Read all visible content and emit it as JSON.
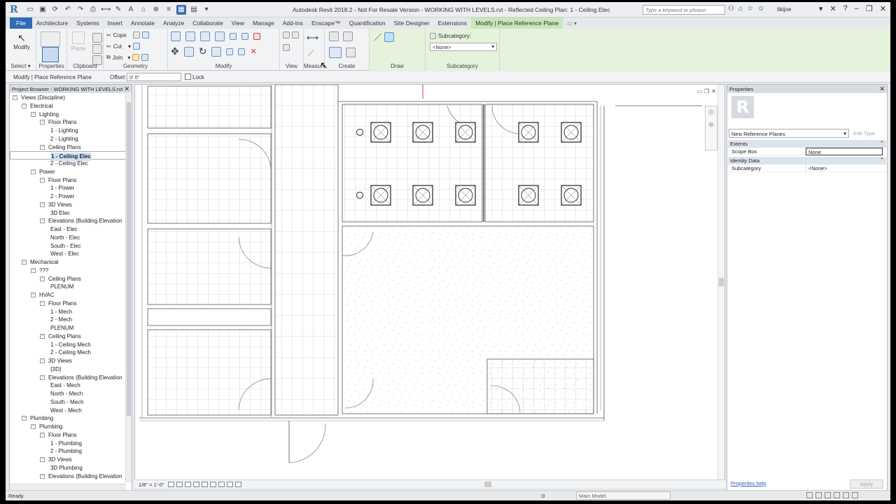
{
  "window": {
    "title": "Autodesk Revit 2018.2 - Not For Resale Version -    WORKING WITH LEVELS.rvt - Reflected Ceiling Plan: 1 - Ceiling Elec",
    "search_placeholder": "Type a keyword or phrase",
    "user": "tikijoe"
  },
  "ribbon_tabs": [
    "File",
    "Architecture",
    "Systems",
    "Insert",
    "Annotate",
    "Analyze",
    "Collaborate",
    "View",
    "Manage",
    "Add-Ins",
    "Enscape™",
    "Quantification",
    "Site Designer",
    "Extensions",
    "Modify | Place Reference Plane"
  ],
  "ribbon": {
    "modify": "Modify",
    "paste": "Paste",
    "cope": "Cope",
    "cut": "Cut",
    "join": "Join",
    "subcategory_label": "Subcategory:",
    "subcategory_value": "<None>",
    "panels": {
      "select": "Select",
      "properties": "Properties",
      "clipboard": "Clipboard",
      "geometry": "Geometry",
      "modify": "Modify",
      "view": "View",
      "measure": "Measure",
      "create": "Create",
      "draw": "Draw",
      "subcategory": "Subcategory"
    }
  },
  "options_bar": {
    "mode": "Modify | Place Reference Plane",
    "offset_label": "Offset:",
    "offset_value": "0' 0\"",
    "lock_label": "Lock"
  },
  "project_browser": {
    "title": "Project Browser - WORKING WITH LEVELS.rvt",
    "items": [
      {
        "label": "Views (Discipline)",
        "level": 0
      },
      {
        "label": "Electrical",
        "level": 1
      },
      {
        "label": "Lighting",
        "level": 2
      },
      {
        "label": "Floor Plans",
        "level": 3
      },
      {
        "label": "1 - Lighting",
        "level": 4
      },
      {
        "label": "2 - Lighting",
        "level": 4
      },
      {
        "label": "Ceiling Plans",
        "level": 3
      },
      {
        "label": "1 - Ceiling Elec",
        "level": 4,
        "selected": true
      },
      {
        "label": "2 - Ceiling Elec",
        "level": 4
      },
      {
        "label": "Power",
        "level": 2
      },
      {
        "label": "Floor Plans",
        "level": 3
      },
      {
        "label": "1 - Power",
        "level": 4
      },
      {
        "label": "2 - Power",
        "level": 4
      },
      {
        "label": "3D Views",
        "level": 3
      },
      {
        "label": "3D Elec",
        "level": 4
      },
      {
        "label": "Elevations (Building Elevation",
        "level": 3
      },
      {
        "label": "East - Elec",
        "level": 4
      },
      {
        "label": "North - Elec",
        "level": 4
      },
      {
        "label": "South - Elec",
        "level": 4
      },
      {
        "label": "West - Elec",
        "level": 4
      },
      {
        "label": "Mechanical",
        "level": 1
      },
      {
        "label": "???",
        "level": 2
      },
      {
        "label": "Ceiling Plans",
        "level": 3
      },
      {
        "label": "PLENUM",
        "level": 4
      },
      {
        "label": "HVAC",
        "level": 2
      },
      {
        "label": "Floor Plans",
        "level": 3
      },
      {
        "label": "1 - Mech",
        "level": 4
      },
      {
        "label": "2 - Mech",
        "level": 4
      },
      {
        "label": "PLENUM",
        "level": 4
      },
      {
        "label": "Ceiling Plans",
        "level": 3
      },
      {
        "label": "1 - Ceiling Mech",
        "level": 4
      },
      {
        "label": "2 - Ceiling Mech",
        "level": 4
      },
      {
        "label": "3D Views",
        "level": 3
      },
      {
        "label": "{3D}",
        "level": 4
      },
      {
        "label": "Elevations (Building Elevation",
        "level": 3
      },
      {
        "label": "East - Mech",
        "level": 4
      },
      {
        "label": "North - Mech",
        "level": 4
      },
      {
        "label": "South - Mech",
        "level": 4
      },
      {
        "label": "West - Mech",
        "level": 4
      },
      {
        "label": "Plumbing",
        "level": 1
      },
      {
        "label": "Plumbing",
        "level": 2
      },
      {
        "label": "Floor Plans",
        "level": 3
      },
      {
        "label": "1 - Plumbing",
        "level": 4
      },
      {
        "label": "2 - Plumbing",
        "level": 4
      },
      {
        "label": "3D Views",
        "level": 3
      },
      {
        "label": "3D Plumbing",
        "level": 4
      },
      {
        "label": "Elevations (Building Elevation",
        "level": 3
      }
    ]
  },
  "view_control": {
    "scale": "1/8\" = 1'-0\""
  },
  "properties": {
    "title": "Properties",
    "type": "New Reference Planes",
    "edit_type": "Edit Type",
    "groups": [
      {
        "name": "Extents",
        "rows": [
          {
            "key": "Scope Box",
            "value": "None"
          }
        ]
      },
      {
        "name": "Identity Data",
        "rows": [
          {
            "key": "Subcategory",
            "value": "<None>"
          }
        ]
      }
    ],
    "help": "Properties help",
    "apply": "Apply"
  },
  "status_bar": {
    "text": "Ready",
    "workset_value": ":0",
    "model": "Main Model"
  },
  "colors": {
    "file_tab": "#2f6ab5",
    "context_tab": "#c7e7b7",
    "context_panel": "#e5f3dc",
    "active_plane": "#e33a3a"
  }
}
